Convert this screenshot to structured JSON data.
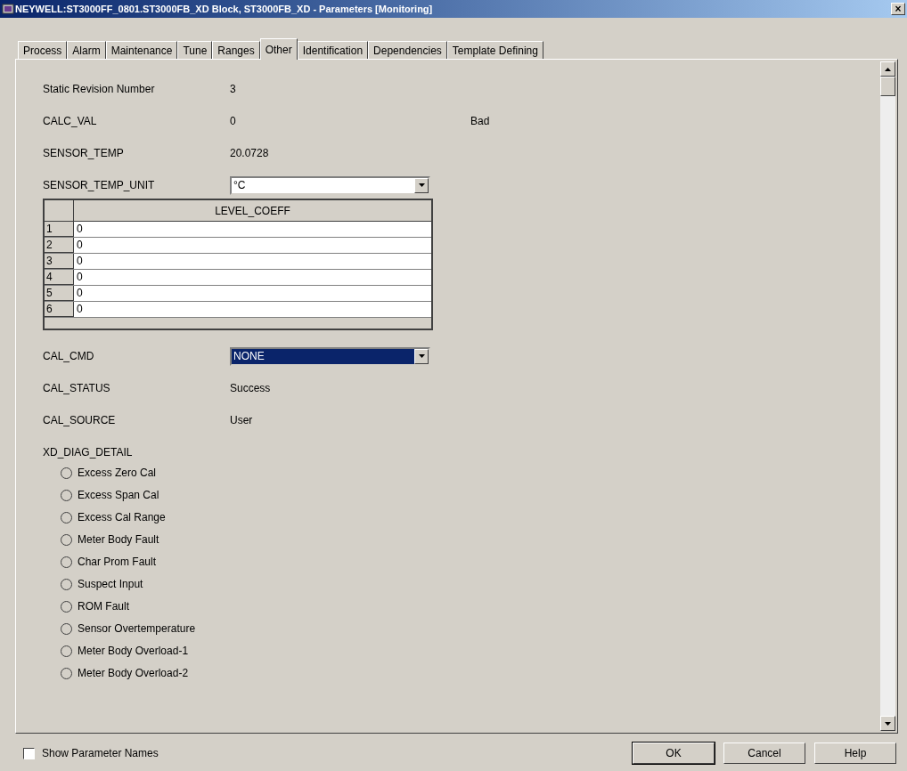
{
  "window": {
    "title": "NEYWELL:ST3000FF_0801.ST3000FB_XD Block, ST3000FB_XD - Parameters [Monitoring]",
    "close": "×"
  },
  "tabs": [
    {
      "label": "Process",
      "selected": false
    },
    {
      "label": "Alarm",
      "selected": false
    },
    {
      "label": "Maintenance",
      "selected": false
    },
    {
      "label": "Tune",
      "selected": false
    },
    {
      "label": "Ranges",
      "selected": false
    },
    {
      "label": "Other",
      "selected": true
    },
    {
      "label": "Identification",
      "selected": false
    },
    {
      "label": "Dependencies",
      "selected": false
    },
    {
      "label": "Template Defining",
      "selected": false
    }
  ],
  "params_top": [
    {
      "kind": "text",
      "label": "Static Revision Number",
      "value": "3"
    },
    {
      "kind": "text",
      "label": "CALC_VAL",
      "value": "0",
      "status": "Bad"
    },
    {
      "kind": "text",
      "label": "SENSOR_TEMP",
      "value": "20.0728"
    },
    {
      "kind": "dropdown",
      "label": "SENSOR_TEMP_UNIT",
      "value": "°C",
      "highlighted": false
    }
  ],
  "table": {
    "columns": [
      "LEVEL_COEFF"
    ],
    "rows": [
      {
        "index": "1",
        "value": "0"
      },
      {
        "index": "2",
        "value": "0"
      },
      {
        "index": "3",
        "value": "0"
      },
      {
        "index": "4",
        "value": "0"
      },
      {
        "index": "5",
        "value": "0"
      },
      {
        "index": "6",
        "value": "0"
      }
    ]
  },
  "params_bottom": [
    {
      "kind": "dropdown",
      "label": "CAL_CMD",
      "value": "NONE",
      "highlighted": true
    },
    {
      "kind": "text",
      "label": "CAL_STATUS",
      "value": "Success"
    },
    {
      "kind": "text",
      "label": "CAL_SOURCE",
      "value": "User"
    }
  ],
  "diag": {
    "label": "XD_DIAG_DETAIL",
    "items": [
      {
        "label": "Excess Zero Cal",
        "checked": false
      },
      {
        "label": "Excess Span Cal",
        "checked": false
      },
      {
        "label": "Excess Cal Range",
        "checked": false
      },
      {
        "label": "Meter Body Fault",
        "checked": false
      },
      {
        "label": "Char Prom Fault",
        "checked": false
      },
      {
        "label": "Suspect Input",
        "checked": false
      },
      {
        "label": "ROM Fault",
        "checked": false
      },
      {
        "label": "Sensor Overtemperature",
        "checked": false
      },
      {
        "label": "Meter Body Overload-1",
        "checked": false
      },
      {
        "label": "Meter Body Overload-2",
        "checked": false
      }
    ]
  },
  "show_parameter_names": {
    "label": "Show Parameter Names",
    "checked": false
  },
  "buttons": [
    "OK",
    "Cancel",
    "Help"
  ]
}
